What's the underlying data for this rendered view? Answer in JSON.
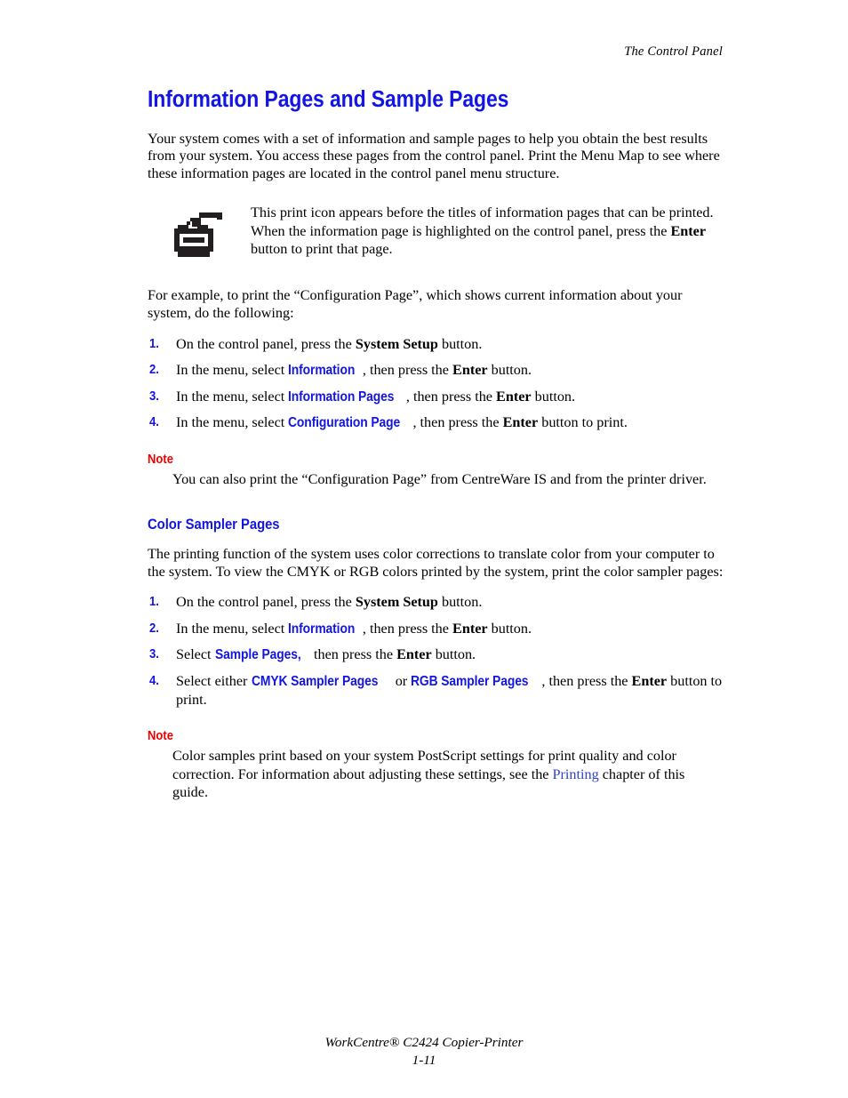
{
  "header": {
    "running_head": "The Control Panel"
  },
  "main": {
    "title": "Information Pages and Sample Pages",
    "intro_paragraph": "Your system comes with a set of information and sample pages to help you obtain the best results from your system. You access these pages from the control panel. Print the Menu Map to see where these information pages are located in the control panel menu structure.",
    "callout": {
      "icon": "printer-icon",
      "text_part1": "This print icon appears before the titles of information pages that can be printed. When the information page is highlighted on the control panel, press the ",
      "enter_bold": "Enter",
      "text_part2": " button to print that page."
    },
    "example_paragraph": "For example, to print the “Configuration Page”, which shows current information about your system, do the following:",
    "steps_a": [
      {
        "num": "1.",
        "pre": "On the control panel, press the ",
        "bold1": "System Setup",
        "mid": " button.",
        "ui": "",
        "post": ""
      },
      {
        "num": "2.",
        "pre": "In the menu, select ",
        "ui": "Information",
        "mid": ", then press the ",
        "bold1": "Enter",
        "post": " button."
      },
      {
        "num": "3.",
        "pre": "In the menu, select ",
        "ui": "Information Pages",
        "mid": ", then press the ",
        "bold1": "Enter",
        "post": " button."
      },
      {
        "num": "4.",
        "pre": "In the menu, select ",
        "ui": "Configuration Page",
        "mid": ", then press the ",
        "bold1": "Enter",
        "post": " button to print."
      }
    ],
    "note1": {
      "label": "Note",
      "body": "You can also print the “Configuration Page” from CentreWare IS and from the printer driver."
    },
    "subsection": {
      "title": "Color Sampler Pages",
      "paragraph": "The printing function of the system uses color corrections to translate color from your computer to the system. To view the CMYK or RGB colors printed by the system, print the color sampler pages:",
      "steps_b": [
        {
          "num": "1.",
          "pre": "On the control panel, press the ",
          "bold1": "System Setup",
          "mid": " button."
        },
        {
          "num": "2.",
          "pre": "In the menu, select ",
          "ui": "Information",
          "mid": ", then press the ",
          "bold1": "Enter",
          "post": " button."
        },
        {
          "num": "3.",
          "pre": "Select ",
          "ui": "Sample Pages,",
          "mid": " then press the ",
          "bold1": "Enter",
          "post": " button."
        },
        {
          "num": "4.",
          "pre": "Select either ",
          "ui": "CMYK Sampler Pages",
          "mid": " or ",
          "ui2": "RGB Sampler Pages",
          "mid2": ", then press the ",
          "bold1": "Enter",
          "post": " button to print."
        }
      ],
      "note2": {
        "label": "Note",
        "body_pre": "Color samples print based on your system PostScript settings for print quality and color correction. For information about adjusting these settings, see the ",
        "link": "Printing",
        "body_post": " chapter of this guide."
      }
    }
  },
  "footer": {
    "product": "WorkCentre® C2424 Copier-Printer",
    "page_number": "1-11"
  },
  "colors": {
    "heading_blue": "#1216e0",
    "note_red": "#ec0000",
    "link_blue": "#3341cc",
    "text_black": "#000000",
    "page_background": "#ffffff"
  }
}
